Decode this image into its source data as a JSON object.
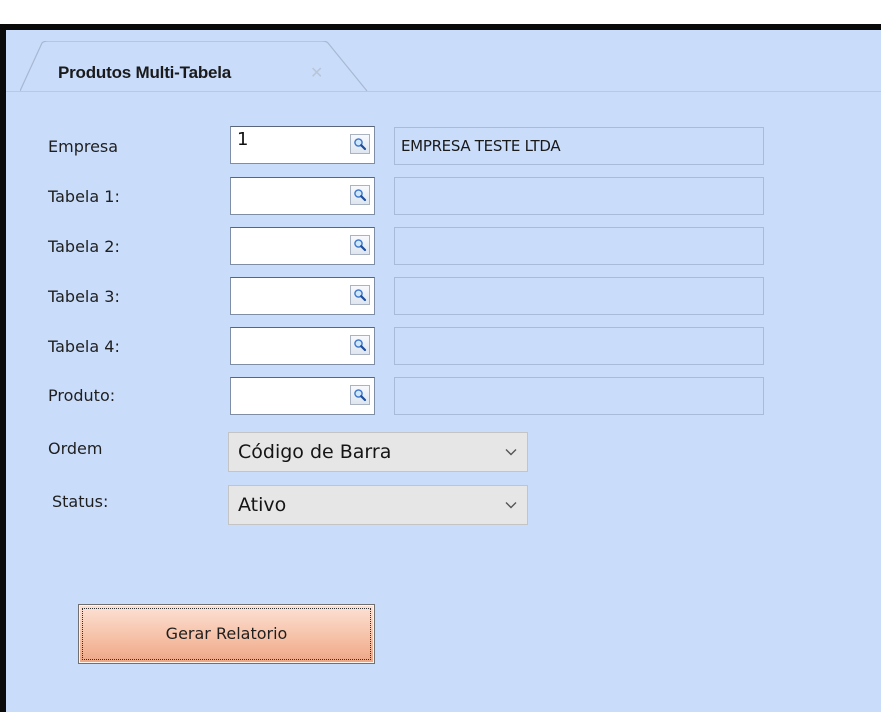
{
  "tab": {
    "label": "Produtos Multi-Tabela",
    "close_glyph": "✕"
  },
  "form": {
    "rows": [
      {
        "label": "Empresa",
        "code": "1",
        "description": "EMPRESA TESTE LTDA"
      },
      {
        "label": "Tabela 1:",
        "code": "",
        "description": ""
      },
      {
        "label": "Tabela 2:",
        "code": "",
        "description": ""
      },
      {
        "label": "Tabela 3:",
        "code": "",
        "description": ""
      },
      {
        "label": "Tabela 4:",
        "code": "",
        "description": ""
      },
      {
        "label": "Produto:",
        "code": "",
        "description": ""
      }
    ],
    "ordem": {
      "label": "Ordem",
      "selected": "Código de Barra"
    },
    "status": {
      "label": "Status:",
      "selected": "Ativo"
    }
  },
  "actions": {
    "generate_label": "Gerar Relatorio"
  },
  "icons": {
    "lookup": "magnifier-icon",
    "dropdown": "chevron-down-icon",
    "close": "close-icon"
  },
  "colors": {
    "background": "#c9dcfa",
    "button_gradient_top": "#fde2d6",
    "button_gradient_bottom": "#eea585"
  }
}
